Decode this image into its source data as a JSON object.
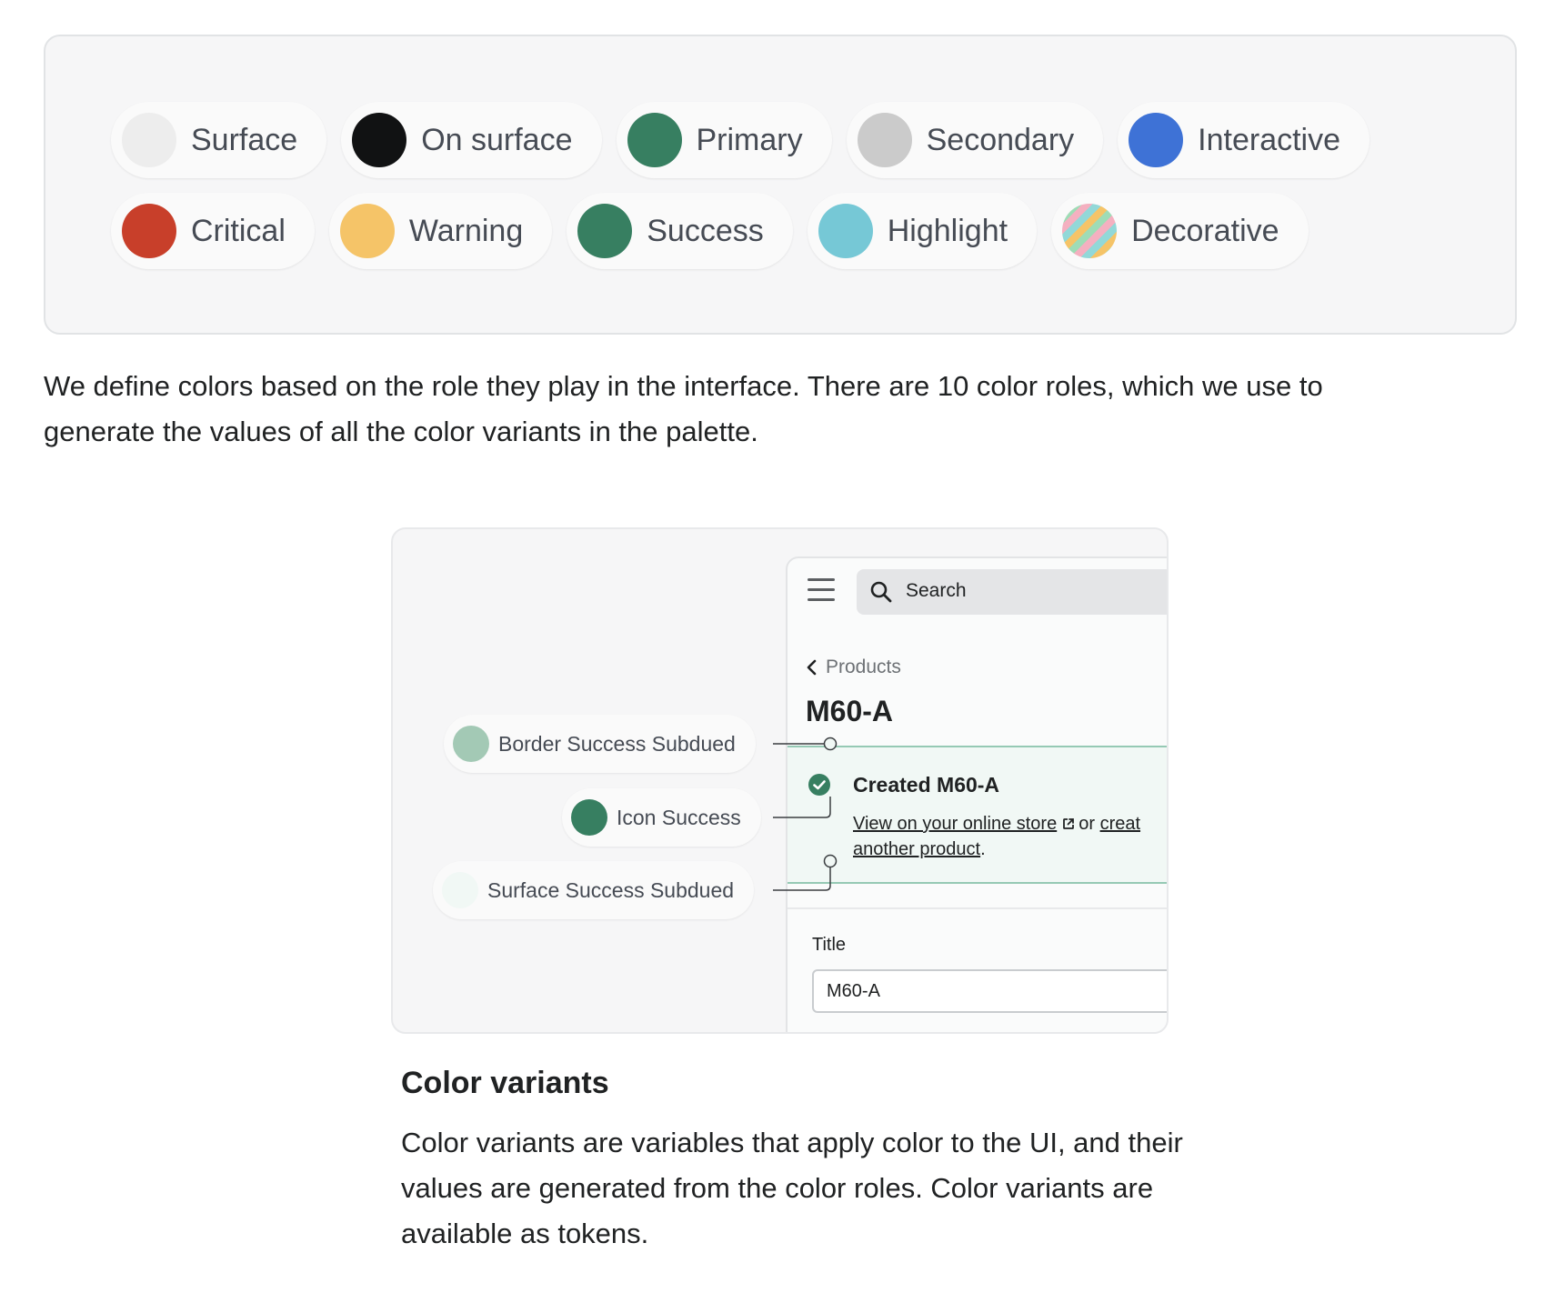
{
  "color_roles": {
    "row1": [
      {
        "label": "Surface",
        "color": "#ededed"
      },
      {
        "label": "On surface",
        "color": "#111213"
      },
      {
        "label": "Primary",
        "color": "#377f61"
      },
      {
        "label": "Secondary",
        "color": "#cbcbcb"
      },
      {
        "label": "Interactive",
        "color": "#3e72d6"
      }
    ],
    "row2": [
      {
        "label": "Critical",
        "color": "#c83f2a"
      },
      {
        "label": "Warning",
        "color": "#f5c468"
      },
      {
        "label": "Success",
        "color": "#377f61"
      },
      {
        "label": "Highlight",
        "color": "#76c8d6"
      },
      {
        "label": "Decorative",
        "color": "striped"
      }
    ]
  },
  "intro_text": "We define colors based on the role they play in the interface. There are 10 color roles, which we use to generate the values of all the color variants in the palette.",
  "illustration": {
    "search_placeholder": "Search",
    "breadcrumb": "Products",
    "page_title": "M60-A",
    "banner": {
      "title": "Created M60-A",
      "link1": "View on your online store",
      "connector": "or",
      "link2a": "creat",
      "link2b": "another product",
      "suffix": "."
    },
    "field_label": "Title",
    "field_value": "M60-A",
    "tokens": [
      {
        "label": "Border Success Subdued",
        "color": "#a3c9b5"
      },
      {
        "label": "Icon Success",
        "color": "#377f61"
      },
      {
        "label": "Surface Success Subdued",
        "color": "#f1f8f5"
      }
    ]
  },
  "section": {
    "heading": "Color variants",
    "body": "Color variants are variables that apply color to the UI, and their values are generated from the color roles. Color variants are available as tokens."
  }
}
